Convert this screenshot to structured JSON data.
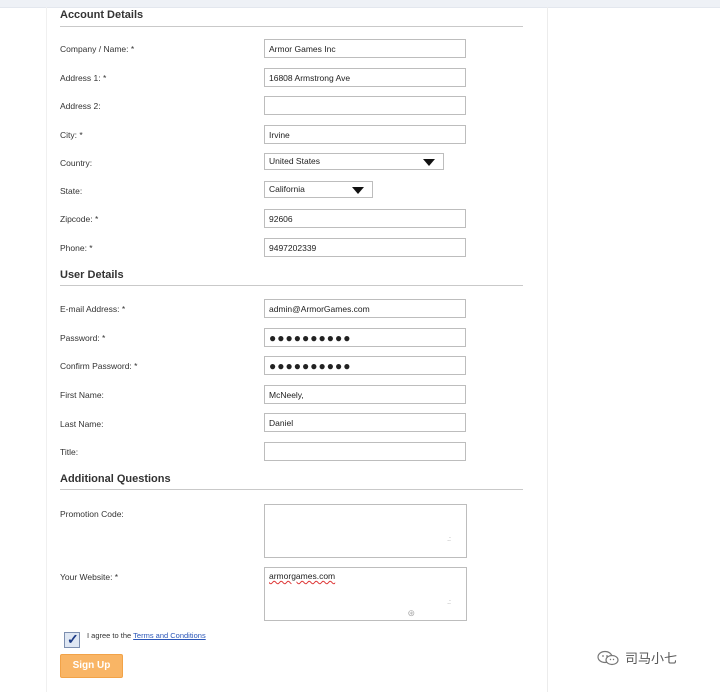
{
  "sections": {
    "account": {
      "title": "Account Details",
      "company_label": "Company / Name: *",
      "company_value": "Armor Games Inc",
      "address1_label": "Address 1: *",
      "address1_value": "16808 Armstrong Ave",
      "address2_label": "Address 2:",
      "address2_value": "",
      "city_label": "City: *",
      "city_value": "Irvine",
      "country_label": "Country:",
      "country_value": "United States",
      "state_label": "State:",
      "state_value": "California",
      "zip_label": "Zipcode: *",
      "zip_value": "92606",
      "phone_label": "Phone: *",
      "phone_value": "9497202339"
    },
    "user": {
      "title": "User Details",
      "email_label": "E-mail Address: *",
      "email_value": "admin@ArmorGames.com",
      "password_label": "Password: *",
      "password_value": "●●●●●●●●●●",
      "confirm_label": "Confirm Password: *",
      "confirm_value": "●●●●●●●●●●",
      "first_label": "First Name:",
      "first_value": "McNeely,",
      "last_label": "Last Name:",
      "last_value": "Daniel",
      "title_label": "Title:",
      "title_value": ""
    },
    "additional": {
      "title": "Additional Questions",
      "promo_label": "Promotion Code:",
      "promo_value": "",
      "website_label": "Your Website: *",
      "website_value": "armorgames.com"
    }
  },
  "agree": {
    "prefix": "I agree to the",
    "link": "Terms and Conditions"
  },
  "signup_label": "Sign Up",
  "watermark": "司马小七",
  "colors": {
    "signup": "#f9b565",
    "link": "#2a56b8",
    "checkbox_check": "#1d3b86"
  }
}
